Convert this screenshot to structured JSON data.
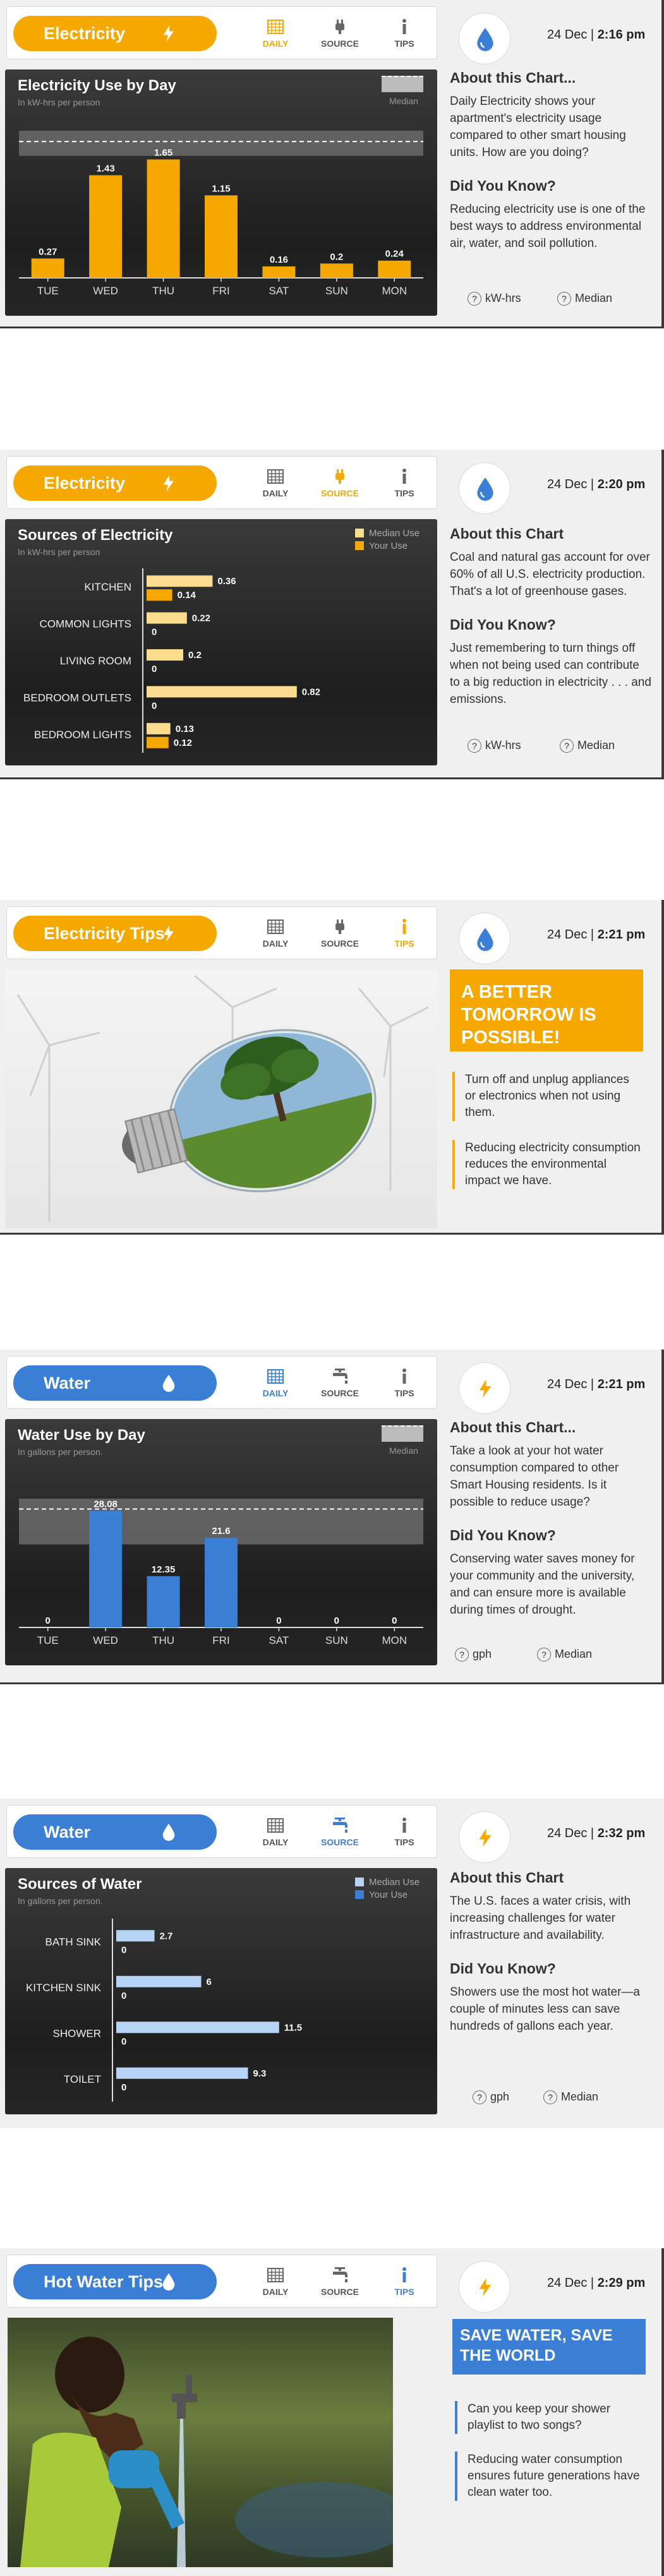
{
  "colors": {
    "electric": "#f5a800",
    "water": "#3a7fd5",
    "text": "#333333"
  },
  "tab_labels": {
    "daily": "DAILY",
    "source": "SOURCE",
    "tips": "TIPS"
  },
  "help": {
    "kwh": "kW-hrs",
    "gph": "gph",
    "median": "Median"
  },
  "screens": [
    {
      "pill": "Electricity",
      "date_day": "24 Dec |",
      "date_time": "2:16 pm",
      "chart_title": "Electricity Use by Day",
      "chart_sub": "In kW-hrs per person",
      "median_label": "Median",
      "about_title": "About this Chart...",
      "about_text": "Daily Electricity shows your apartment's electricity usage compared to other smart housing units. How are you doing?",
      "dyk_title": "Did You Know?",
      "dyk_text": "Reducing electricity use is one of the best ways to address environmental air, water, and soil pollution."
    },
    {
      "pill": "Electricity",
      "date_day": "24 Dec |",
      "date_time": "2:20 pm",
      "chart_title": "Sources of Electricity",
      "chart_sub": "In kW-hrs per person",
      "legend_median": "Median Use",
      "legend_your": "Your Use",
      "about_title": "About this Chart",
      "about_text": "Coal and natural gas account for over 60% of all U.S. electricity production. That's a lot of greenhouse gases.",
      "dyk_title": "Did You Know?",
      "dyk_text": "Just remembering to turn things off when not being used can contribute to a big reduction in electricity . . . and emissions."
    },
    {
      "pill": "Electricity Tips",
      "date_day": "24 Dec |",
      "date_time": "2:21 pm",
      "headline": "A BETTER TOMORROW IS POSSIBLE!",
      "tip1": "Turn off and unplug appliances or electronics when not using them.",
      "tip2": "Reducing electricity consumption reduces the environmental impact we have."
    },
    {
      "pill": "Water",
      "date_day": "24 Dec |",
      "date_time": "2:21 pm",
      "chart_title": "Water Use by Day",
      "chart_sub": "In gallons per person.",
      "median_label": "Median",
      "about_title": "About this Chart...",
      "about_text": "Take a look at your hot water consumption compared to other Smart Housing residents. Is it possible to reduce usage?",
      "dyk_title": "Did You Know?",
      "dyk_text": "Conserving water saves money for your community and the university, and can ensure more is available during times of drought."
    },
    {
      "pill": "Water",
      "date_day": "24 Dec |",
      "date_time": "2:32 pm",
      "chart_title": "Sources of Water",
      "chart_sub": "In gallons per person.",
      "legend_median": "Median Use",
      "legend_your": "Your Use",
      "about_title": "About this Chart",
      "about_text": "The U.S. faces a water crisis, with increasing challenges for water infrastructure and availability.",
      "dyk_title": "Did You Know?",
      "dyk_text": "Showers use the most hot water—a couple of minutes less can save hundreds of gallons each year."
    },
    {
      "pill": "Hot Water Tips",
      "date_day": "24 Dec |",
      "date_time": "2:29 pm",
      "headline": "SAVE WATER, SAVE THE WORLD",
      "tip1": "Can you keep your shower playlist to two songs?",
      "tip2": "Reducing water consumption ensures future generations have clean water too."
    }
  ],
  "chart_data": [
    {
      "type": "bar",
      "title": "Electricity Use by Day",
      "ylabel": "In kW-hrs per person",
      "categories": [
        "TUE",
        "WED",
        "THU",
        "FRI",
        "SAT",
        "SUN",
        "MON"
      ],
      "values": [
        0.27,
        1.43,
        1.65,
        1.15,
        0.16,
        0.2,
        0.24
      ],
      "value_labels": [
        "0.27",
        "1.43",
        "1.65",
        "1.15",
        "0.16",
        "0.2",
        "0.24"
      ],
      "ylim": [
        0,
        2.2
      ],
      "median_band": [
        1.7,
        2.05
      ],
      "median_line": 1.9,
      "color": "#f5a800"
    },
    {
      "type": "bar",
      "orientation": "horizontal",
      "title": "Sources of Electricity",
      "ylabel": "In kW-hrs per person",
      "categories": [
        "KITCHEN",
        "COMMON LIGHTS",
        "LIVING ROOM",
        "BEDROOM OUTLETS",
        "BEDROOM LIGHTS"
      ],
      "series": [
        {
          "name": "Median Use",
          "values": [
            0.36,
            0.22,
            0.2,
            0.82,
            0.13
          ],
          "labels": [
            "0.36",
            "0.22",
            "0.2",
            "0.82",
            "0.13"
          ],
          "color": "#fbdc8e"
        },
        {
          "name": "Your Use",
          "values": [
            0.14,
            0,
            0,
            0,
            0.12
          ],
          "labels": [
            "0.14",
            "0",
            "0",
            "0",
            "0.12"
          ],
          "color": "#f5a800"
        }
      ],
      "xlim": [
        0,
        0.9
      ]
    },
    {
      "type": "bar",
      "title": "Water Use by Day",
      "ylabel": "In gallons per person.",
      "categories": [
        "TUE",
        "WED",
        "THU",
        "FRI",
        "SAT",
        "SUN",
        "MON"
      ],
      "values": [
        0,
        28.08,
        12.35,
        21.6,
        0,
        0,
        0
      ],
      "value_labels": [
        "0",
        "28.08",
        "12.35",
        "21.6",
        "0",
        "0",
        "0"
      ],
      "ylim": [
        0,
        38
      ],
      "median_band": [
        20,
        31
      ],
      "median_line": 28.5,
      "color": "#3a7fd5"
    },
    {
      "type": "bar",
      "orientation": "horizontal",
      "title": "Sources of Water",
      "ylabel": "In gallons per person.",
      "categories": [
        "BATH SINK",
        "KITCHEN SINK",
        "SHOWER",
        "TOILET"
      ],
      "series": [
        {
          "name": "Median Use",
          "values": [
            2.7,
            6,
            11.5,
            9.3
          ],
          "labels": [
            "2.7",
            "6",
            "11.5",
            "9.3"
          ],
          "color": "#b7d3f6"
        },
        {
          "name": "Your Use",
          "values": [
            0,
            0,
            0,
            0
          ],
          "labels": [
            "0",
            "0",
            "0",
            "0"
          ],
          "color": "#3a7fd5"
        }
      ],
      "xlim": [
        0,
        12
      ]
    }
  ]
}
